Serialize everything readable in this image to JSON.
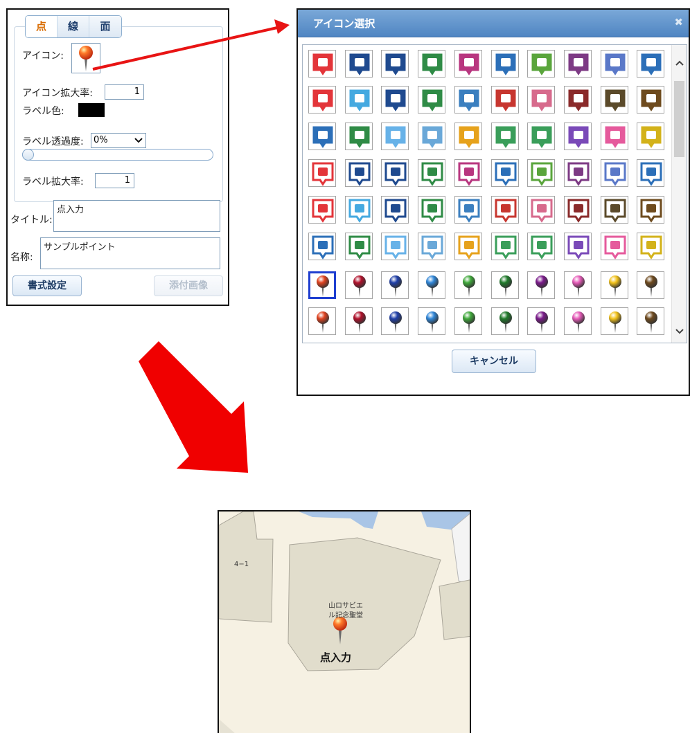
{
  "style_panel": {
    "tabs": [
      {
        "label": "点",
        "active": true
      },
      {
        "label": "線",
        "active": false
      },
      {
        "label": "面",
        "active": false
      }
    ],
    "icon_label": "アイコン:",
    "icon_scale_label": "アイコン拡大率:",
    "icon_scale_value": "1",
    "label_color_label": "ラベル色:",
    "label_color": "#000000",
    "label_opacity_label": "ラベル透過度:",
    "label_opacity_value": "0%",
    "label_scale_label": "ラベル拡大率:",
    "label_scale_value": "1",
    "title_label": "タイトル:",
    "title_value": "点入力",
    "name_label": "名称:",
    "name_value": "サンプルポイント",
    "format_button": "書式設定",
    "attach_button": "添付画像"
  },
  "icon_dialog": {
    "title": "アイコン選択",
    "close": "✖",
    "scroll_up": "^",
    "scroll_down": "v",
    "cancel_button": "キャンセル",
    "icon_rows": [
      [
        "camera-icon",
        "car-icon",
        "bus-icon",
        "bicycle-icon",
        "bag-icon",
        "restroom-icon",
        "cafe-icon",
        "bar-icon",
        "airport-icon",
        "train-icon"
      ],
      [
        "hospital-icon",
        "smoking-icon",
        "parking-icon",
        "golf-icon",
        "gas-station-icon",
        "restaurant-icon",
        "flower-icon",
        "maple-icon",
        "bear-icon",
        "boar-icon"
      ],
      [
        "book-icon",
        "government-icon",
        "sun-icon",
        "factory-icon",
        "radio-icon",
        "house-icon",
        "elderly-icon",
        "star-icon",
        "heart-icon",
        "yen-icon"
      ]
    ],
    "icon_colors_row1": [
      "#e3353a",
      "#1f4a8f",
      "#1f4a8f",
      "#2f8b46",
      "#b8367f",
      "#2c6fb8",
      "#5aa53c",
      "#7d3a84",
      "#5a78c8",
      "#2c6fb8"
    ],
    "icon_colors_row2": [
      "#e3353a",
      "#45a9e0",
      "#1f4a8f",
      "#2f8b46",
      "#3b7fbf",
      "#c7362f",
      "#d76a8c",
      "#8a2a2a",
      "#5b4a2a",
      "#6e4b1e"
    ],
    "icon_colors_row3": [
      "#2c6fb8",
      "#2f8b46",
      "#67b2e8",
      "#6aa8d8",
      "#e6a21c",
      "#3a9e5a",
      "#3a9e5a",
      "#7a4ab8",
      "#e55a9c",
      "#d3b21a"
    ],
    "pin_colors": [
      "#e0421f",
      "#b0102a",
      "#1f3fa8",
      "#2f86d8",
      "#3fa83a",
      "#1f7a2a",
      "#7a1a8a",
      "#e65ab8",
      "#f2c21a",
      "#6e4a1e"
    ],
    "selected_pin": 0
  },
  "map": {
    "block_label": "4−1",
    "building_label_line1": "山ロサビエ",
    "building_label_line2": "ル記念聖堂",
    "point_caption": "点入力"
  }
}
